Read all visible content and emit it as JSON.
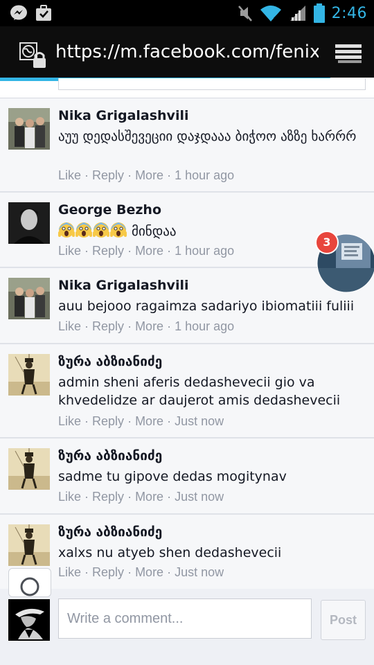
{
  "status_bar": {
    "time": "2:46"
  },
  "url_bar": {
    "url": "https://m.facebook.com/fenixg"
  },
  "comments": [
    {
      "author": "Nika Grigalashvili",
      "text": "აუუ დედასშევეციი დაჯდააა ბიჭოო აზზე ხარრრ",
      "actions": {
        "like": "Like",
        "reply": "Reply",
        "more": "More",
        "time": "1 hour ago"
      }
    },
    {
      "author": "George Bezho",
      "text": "მინდაა",
      "emoji_count": 4,
      "actions": {
        "like": "Like",
        "reply": "Reply",
        "more": "More",
        "time": "1 hour ago"
      }
    },
    {
      "author": "Nika Grigalashvili",
      "text": "auu bejooo ragaimza sadariyo ibiomatiii fuliii",
      "actions": {
        "like": "Like",
        "reply": "Reply",
        "more": "More",
        "time": "1 hour ago"
      }
    },
    {
      "author": "ზურა აბზიანიძე",
      "text": "admin sheni aferis dedashevecii gio va khvedelidze ar daujerot amis dedashevecii",
      "actions": {
        "like": "Like",
        "reply": "Reply",
        "more": "More",
        "time": "Just now"
      }
    },
    {
      "author": "ზურა აბზიანიძე",
      "text": "sadme tu gipove dedas mogitynav",
      "actions": {
        "like": "Like",
        "reply": "Reply",
        "more": "More",
        "time": "Just now"
      }
    },
    {
      "author": "ზურა აბზიანიძე",
      "text": "xalxs nu atyeb shen dedashevecii",
      "actions": {
        "like": "Like",
        "reply": "Reply",
        "more": "More",
        "time": "Just now"
      }
    }
  ],
  "composer": {
    "placeholder": "Write a comment...",
    "post_label": "Post"
  },
  "chat_head": {
    "badge_count": "3"
  },
  "separator": " · "
}
